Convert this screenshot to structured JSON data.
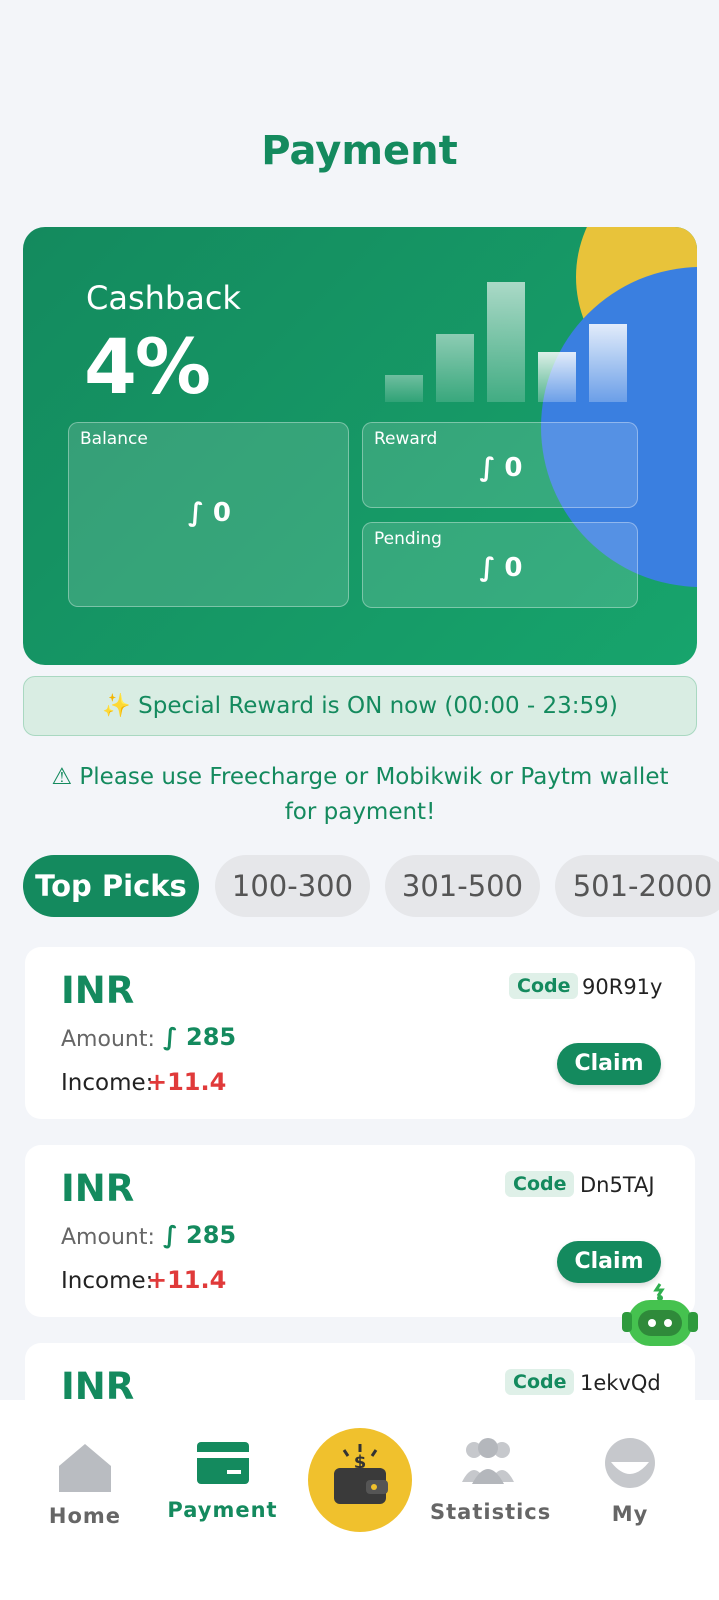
{
  "page": {
    "title": "Payment"
  },
  "card": {
    "cashback_label": "Cashback",
    "cashback_value": "4%",
    "balance": {
      "label": "Balance",
      "value": "∫ 0"
    },
    "reward": {
      "label": "Reward",
      "value": "∫ 0"
    },
    "pending": {
      "label": "Pending",
      "value": "∫ 0"
    }
  },
  "notice": "✨ Special Reward is ON now (00:00 - 23:59)",
  "warning": "⚠ Please use Freecharge or Mobikwik or Paytm wallet for payment!",
  "filters": [
    "Top Picks",
    "100-300",
    "301-500",
    "501-2000"
  ],
  "transactions": [
    {
      "currency": "INR",
      "code_label": "Code",
      "code": "90R91y",
      "amount_label": "Amount:",
      "amount": "∫ 285",
      "income_label": "Income:",
      "income": "+11.4",
      "action": "Claim"
    },
    {
      "currency": "INR",
      "code_label": "Code",
      "code": "Dn5TAJ",
      "amount_label": "Amount:",
      "amount": "∫ 285",
      "income_label": "Income:",
      "income": "+11.4",
      "action": "Claim"
    },
    {
      "currency": "INR",
      "code_label": "Code",
      "code": "1ekvQd"
    }
  ],
  "nav": {
    "home": "Home",
    "payment": "Payment",
    "statistics": "Statistics",
    "my": "My"
  },
  "colors": {
    "primary": "#148a5e",
    "accent": "#f0c12d",
    "income": "#e03a3a",
    "blue": "#3a7fe0"
  },
  "icons": [
    "home-icon",
    "card-icon",
    "wallet-icon",
    "users-icon",
    "profile-icon",
    "robot-assistant-icon"
  ]
}
